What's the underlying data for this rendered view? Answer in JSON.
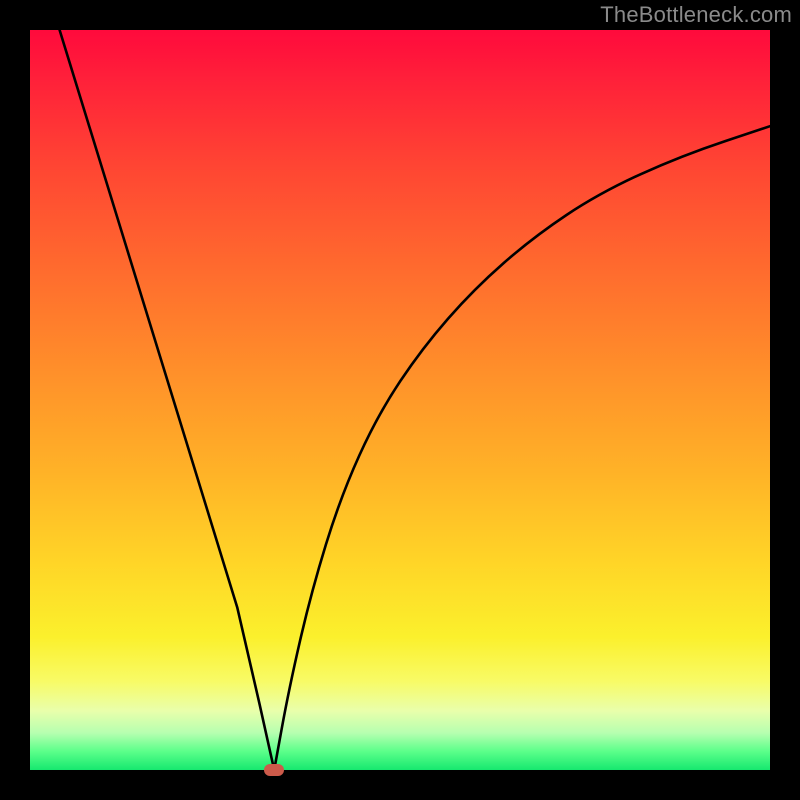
{
  "watermark": "TheBottleneck.com",
  "chart_data": {
    "type": "line",
    "title": "",
    "xlabel": "",
    "ylabel": "",
    "xlim": [
      0,
      100
    ],
    "ylim": [
      0,
      100
    ],
    "background_gradient": [
      "#ff0a3c",
      "#ff6a2e",
      "#ffd527",
      "#f8fb66",
      "#16e86f"
    ],
    "series": [
      {
        "name": "left-branch",
        "x": [
          4,
          8,
          12,
          16,
          20,
          24,
          28,
          31,
          33
        ],
        "values": [
          100,
          87,
          74,
          61,
          48,
          35,
          22,
          9,
          0
        ]
      },
      {
        "name": "right-branch",
        "x": [
          33,
          35,
          38,
          42,
          47,
          53,
          60,
          68,
          77,
          88,
          100
        ],
        "values": [
          0,
          11,
          24,
          37,
          48,
          57,
          65,
          72,
          78,
          83,
          87
        ]
      }
    ],
    "marker": {
      "x": 33,
      "y": 0,
      "color": "#cc5a4a"
    }
  }
}
